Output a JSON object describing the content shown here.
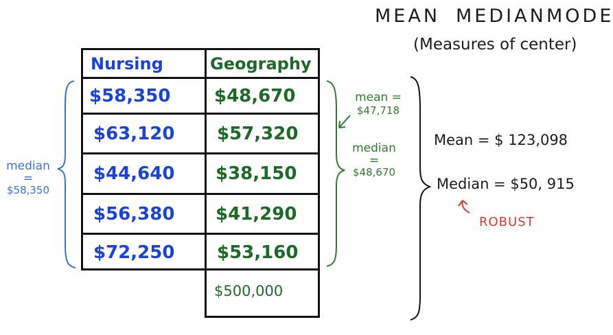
{
  "header": {
    "title_words": [
      "MEAN",
      "MEDIAN",
      "MODE"
    ],
    "subtitle": "(Measures of center)"
  },
  "table": {
    "columns": [
      "Nursing",
      "Geography"
    ],
    "rows": [
      [
        "$58,350",
        "$48,670"
      ],
      [
        "$63,120",
        "$57,320"
      ],
      [
        "$44,640",
        "$38,150"
      ],
      [
        "$56,380",
        "$41,290"
      ],
      [
        "$72,250",
        "$53,160"
      ],
      [
        "",
        "$500,000"
      ]
    ]
  },
  "nursing_note": {
    "label": "median",
    "eq": "=",
    "value": "$58,350"
  },
  "geography_notes": {
    "mean_label": "mean =",
    "mean_value": "$47,718",
    "median_label": "median",
    "median_eq": "=",
    "median_value": "$48,670"
  },
  "summary": {
    "mean": "Mean = $ 123,098",
    "median": "Median = $50, 915",
    "robust": "ROBUST"
  },
  "colors": {
    "nursing": "#1a44d8",
    "geography": "#1d6a26",
    "robust": "#d63a2e",
    "ink": "#1c1c1c"
  }
}
